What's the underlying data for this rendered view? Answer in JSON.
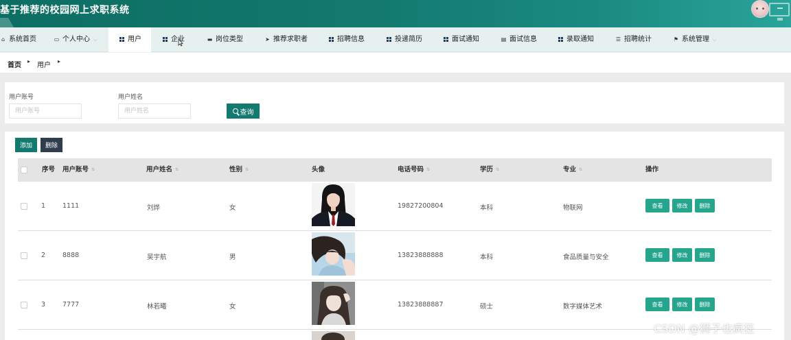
{
  "header": {
    "title": "基于推荐的校园网上求职系统"
  },
  "nav": {
    "items": [
      {
        "label": "系统首页",
        "icon": "home-icon"
      },
      {
        "label": "个人中心",
        "icon": "card-icon",
        "has_dropdown": true
      },
      {
        "label": "用户",
        "icon": "grid-icon",
        "active": true
      },
      {
        "label": "企业",
        "icon": "grid-icon"
      },
      {
        "label": "岗位类型",
        "icon": "briefcase-icon"
      },
      {
        "label": "推荐求职者",
        "icon": "send-icon"
      },
      {
        "label": "招聘信息",
        "icon": "grid-icon"
      },
      {
        "label": "投递简历",
        "icon": "grid-icon"
      },
      {
        "label": "面试通知",
        "icon": "grid-icon"
      },
      {
        "label": "面试信息",
        "icon": "calendar-icon"
      },
      {
        "label": "录取通知",
        "icon": "grid-icon"
      },
      {
        "label": "招聘统计",
        "icon": "sliders-icon"
      },
      {
        "label": "系统管理",
        "icon": "flag-icon",
        "has_dropdown": true
      }
    ]
  },
  "breadcrumb": {
    "items": [
      "首页",
      "用户"
    ]
  },
  "search": {
    "account_label": "用户账号",
    "account_placeholder": "用户账号",
    "name_label": "用户姓名",
    "name_placeholder": "用户姓名",
    "query_label": "查询"
  },
  "actions": {
    "add_label": "添加",
    "delete_label": "删除"
  },
  "table": {
    "columns": {
      "index": "序号",
      "account": "用户账号",
      "name": "用户姓名",
      "gender": "性别",
      "avatar": "头像",
      "phone": "电话号码",
      "education": "学历",
      "major": "专业",
      "operation": "操作"
    },
    "row_actions": {
      "view": "查看",
      "edit": "修改",
      "delete": "删除"
    },
    "rows": [
      {
        "index": "1",
        "account": "1111",
        "name": "刘烨",
        "gender": "女",
        "phone": "19827200804",
        "education": "本科",
        "major": "物联网"
      },
      {
        "index": "2",
        "account": "8888",
        "name": "吴宇航",
        "gender": "男",
        "phone": "13823888888",
        "education": "本科",
        "major": "食品质量与安全"
      },
      {
        "index": "3",
        "account": "7777",
        "name": "林若曦",
        "gender": "女",
        "phone": "13823888887",
        "education": "硕士",
        "major": "数字媒体艺术"
      }
    ]
  },
  "watermark": "CSDN @狮子也疯狂",
  "colors": {
    "primary": "#137a70",
    "action": "#25a68c",
    "dark_button": "#2e3e4d"
  }
}
